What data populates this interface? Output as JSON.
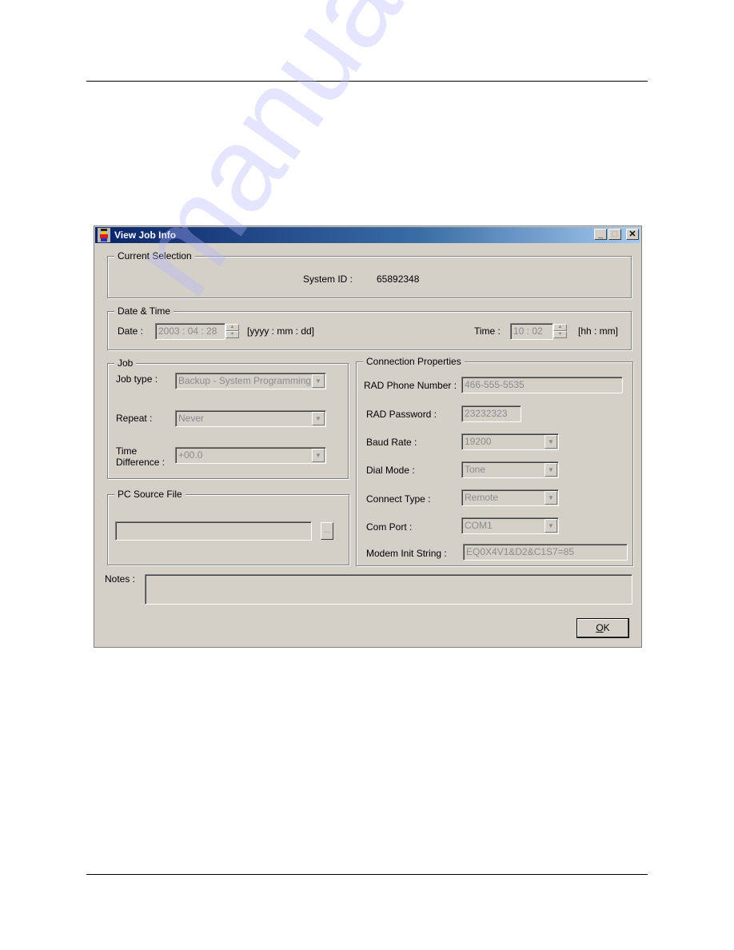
{
  "page": {
    "watermark": "manualslib"
  },
  "window": {
    "title": "View Job Info",
    "controls": {
      "minimize": "_",
      "maximize": "□",
      "close": "✕"
    }
  },
  "current_selection": {
    "legend": "Current Selection",
    "system_id_label": "System ID :",
    "system_id_value": "65892348"
  },
  "date_time": {
    "legend": "Date & Time",
    "date_label": "Date :",
    "date_value": "2003 : 04 : 28",
    "date_format": "[yyyy : mm : dd]",
    "time_label": "Time :",
    "time_value": "10 : 02",
    "time_format": "[hh : mm]"
  },
  "job": {
    "legend": "Job",
    "job_type_label": "Job type :",
    "job_type_value": "Backup - System Programming",
    "repeat_label": "Repeat :",
    "repeat_value": "Never",
    "time_difference_label_1": "Time",
    "time_difference_label_2": "Difference :",
    "time_difference_value": "+00.0"
  },
  "pc_source_file": {
    "legend": "PC Source File",
    "value": "",
    "browse_label": "..."
  },
  "connection": {
    "legend": "Connection Properties",
    "rad_phone_label": "RAD Phone Number :",
    "rad_phone_value": "466-555-5535",
    "rad_password_label": "RAD Password :",
    "rad_password_value": "23232323",
    "baud_rate_label": "Baud Rate :",
    "baud_rate_value": "19200",
    "dial_mode_label": "Dial Mode :",
    "dial_mode_value": "Tone",
    "connect_type_label": "Connect Type :",
    "connect_type_value": "Remote",
    "com_port_label": "Com Port :",
    "com_port_value": "COM1",
    "modem_init_label": "Modem Init String :",
    "modem_init_value": "EQ0X4V1&D2&C1S7=85"
  },
  "notes": {
    "label": "Notes :",
    "value": ""
  },
  "buttons": {
    "ok_mnemonic": "O",
    "ok_rest": "K"
  },
  "icons": {
    "arrow_down": "▼",
    "arrow_up": "▲"
  }
}
